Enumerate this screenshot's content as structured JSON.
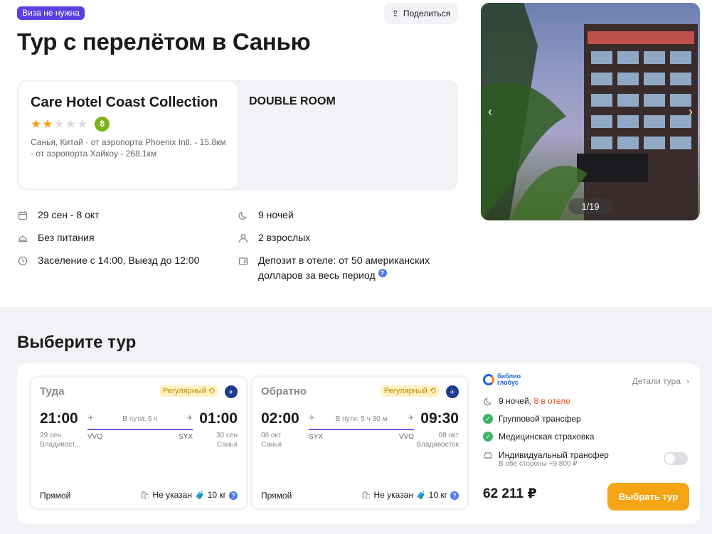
{
  "header": {
    "visa_badge": "Виза не нужна",
    "share_label": "Поделиться",
    "title": "Тур с перелётом в Санью"
  },
  "hotel": {
    "name": "Care Hotel Coast Collection",
    "stars": 2,
    "stars_max": 5,
    "rating": "8",
    "address": "Санья, Китай · от аэропорта Phoenix Intl. - 15.8км · от аэропорта Хайкоу - 268.1км",
    "room": "DOUBLE ROOM",
    "photo_counter": "1/19"
  },
  "info": {
    "dates": "29 сен - 8 окт",
    "nights": "9 ночей",
    "meals": "Без питания",
    "guests": "2 взрослых",
    "checkin": "Заселение с 14:00, Выезд до 12:00",
    "deposit": "Депозит в отеле: от 50 американских долларов за весь период"
  },
  "tour": {
    "section_title": "Выберите тур",
    "outbound": {
      "label": "Туда",
      "badge": "Регулярный",
      "dep_time": "21:00",
      "dep_date": "29 сен",
      "dep_city": "Владивост...",
      "arr_time": "01:00",
      "arr_date": "30 сен",
      "arr_city": "Санья",
      "duration": "В пути: 6 ч",
      "from_code": "VVO",
      "to_code": "SYX",
      "type": "Прямой",
      "hand_luggage": "Не указан",
      "baggage": "10 кг"
    },
    "return": {
      "label": "Обратно",
      "badge": "Регулярный",
      "dep_time": "02:00",
      "dep_date": "08 окт",
      "dep_city": "Санья",
      "arr_time": "09:30",
      "arr_date": "08 окт",
      "arr_city": "Владивосток",
      "duration": "В пути: 5 ч 30 м",
      "from_code": "SYX",
      "to_code": "VVO",
      "type": "Прямой",
      "hand_luggage": "Не указан",
      "baggage": "10 кг"
    },
    "operator_line1": "библио",
    "operator_line2": "глобус",
    "details_label": "Детали тура",
    "nights_text": "9 ночей,",
    "nights_hotel": "8 в отеле",
    "feature1": "Групповой трансфер",
    "feature2": "Медицинская страховка",
    "feature3": "Индивидуальный трансфер",
    "feature3_sub": "В обе стороны +9 800 ₽",
    "price": "62 211 ₽",
    "choose_label": "Выбрать тур"
  },
  "colors": {
    "accent": "#5b3fe0",
    "cta": "#f5a514",
    "rating": "#7cb518",
    "route_line": "#6a5ae0"
  }
}
